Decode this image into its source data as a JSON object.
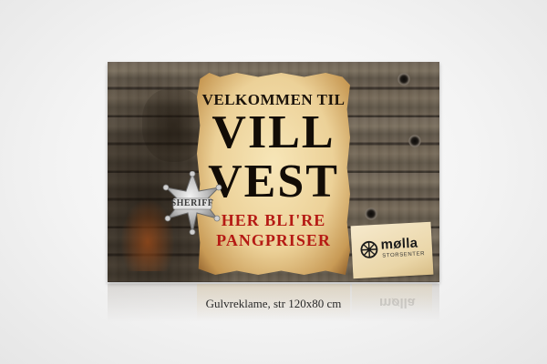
{
  "poster": {
    "line1": "VELKOMMEN TIL",
    "line2": "VILL",
    "line3": "VEST",
    "line4": "HER BLI'RE",
    "line5": "PANGPRISER",
    "badge_label": "SHERIFF"
  },
  "logo": {
    "name": "mølla",
    "sub": "STORSENTER",
    "icon": "wagon-wheel-icon"
  },
  "caption": "Gulvreklame, str 120x80 cm",
  "colors": {
    "headline": "#120c06",
    "accent_red": "#b51a14",
    "paper": "#ecd198",
    "wood": "#6f6457",
    "background": "#f3f3f3"
  }
}
